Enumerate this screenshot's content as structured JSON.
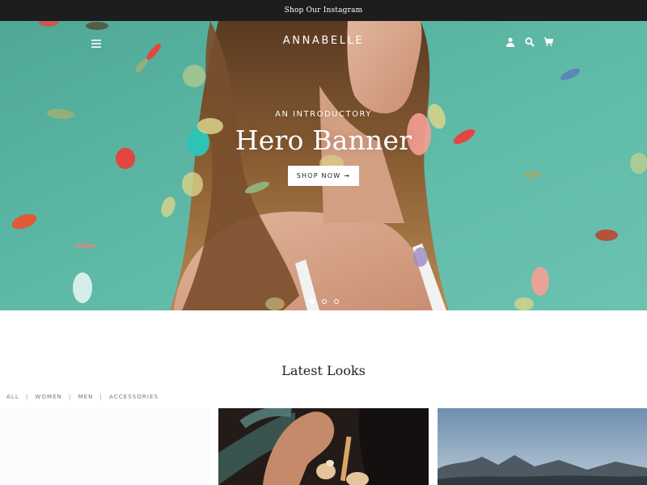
{
  "announcement": {
    "text": "Shop Our Instagram"
  },
  "header": {
    "logo": "ANNABELLE",
    "icons": {
      "menu": "hamburger-icon",
      "account": "account-icon",
      "search": "search-icon",
      "cart": "cart-icon"
    }
  },
  "hero": {
    "kicker": "AN INTRODUCTORY",
    "title": "Hero Banner",
    "button_label": "SHOP NOW",
    "button_icon": "arrow-right-icon",
    "slides_total": 3,
    "active_slide": 1
  },
  "latest_looks": {
    "title": "Latest Looks",
    "filters": [
      "ALL",
      "WOMEN",
      "MEN",
      "ACCESSORIES"
    ]
  },
  "colors": {
    "announcement_bg": "#1d1d1d",
    "hero_teal": "#59b7a4",
    "text_dark": "#222222",
    "filter_gray": "#757575"
  }
}
